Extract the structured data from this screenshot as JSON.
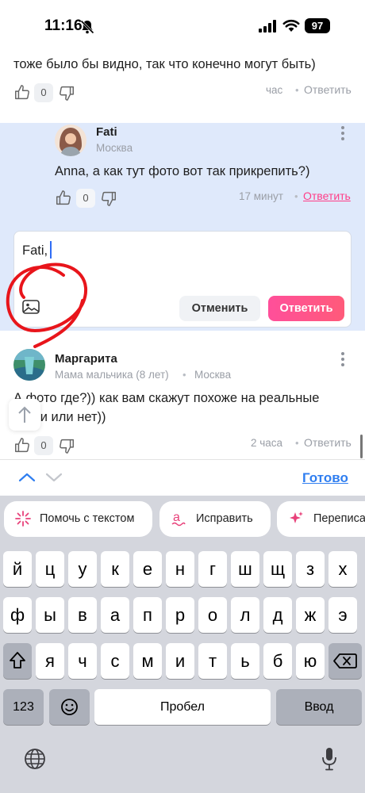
{
  "status_bar": {
    "time": "11:16",
    "battery": "97"
  },
  "comments": {
    "first": {
      "text_tail": "тоже было бы видно, так что конечно могут быть)",
      "likes": "0",
      "time": "час",
      "reply": "Ответить"
    },
    "fati": {
      "name": "Fati",
      "location": "Москва",
      "text": "Anna, а как тут фото вот так прикрепить?)",
      "likes": "0",
      "time": "17 минут",
      "reply": "Ответить"
    },
    "margarita": {
      "name": "Маргарита",
      "subtitle": "Мама мальчика (8 лет)",
      "location": "Москва",
      "text_line1": "А фото где?)) как вам скажут похоже на реальные",
      "text_line2": "носки или нет))",
      "likes": "0",
      "time": "2 часа",
      "reply": "Ответить"
    }
  },
  "reply_box": {
    "value": "Fati,",
    "cancel_label": "Отменить",
    "submit_label": "Ответить"
  },
  "accessory_bar": {
    "done_label": "Готово"
  },
  "keyboard": {
    "suggestions": [
      "Помочь с текстом",
      "Исправить",
      "Переписать"
    ],
    "row1": [
      "й",
      "ц",
      "у",
      "к",
      "е",
      "н",
      "г",
      "ш",
      "щ",
      "з",
      "х"
    ],
    "row2": [
      "ф",
      "ы",
      "в",
      "а",
      "п",
      "р",
      "о",
      "л",
      "д",
      "ж",
      "э"
    ],
    "row3": [
      "я",
      "ч",
      "с",
      "м",
      "и",
      "т",
      "ь",
      "б",
      "ю"
    ],
    "numbers_label": "123",
    "space_label": "Пробел",
    "enter_label": "Ввод"
  },
  "colors": {
    "accent_pink": "#ff3e88",
    "link_blue": "#2f7ef0",
    "reply_bg": "#dfe9fb"
  },
  "icons": [
    "bell-muted-icon",
    "signal-icon",
    "wifi-icon",
    "battery-icon",
    "thumb-up-icon",
    "thumb-down-icon",
    "more-icon",
    "image-icon",
    "arrow-up-icon",
    "chevron-up-icon",
    "chevron-down-icon",
    "sparkle-icon",
    "spell-check-icon",
    "shift-icon",
    "backspace-icon",
    "emoji-icon",
    "globe-icon",
    "microphone-icon"
  ]
}
